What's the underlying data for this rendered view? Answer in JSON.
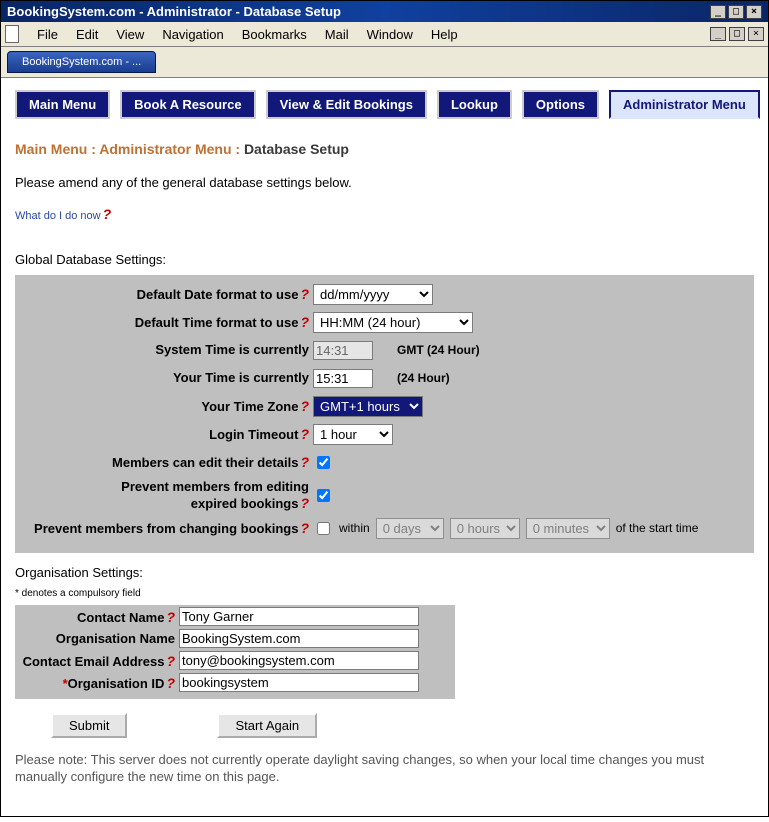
{
  "window": {
    "title": "BookingSystem.com - Administrator - Database Setup"
  },
  "menubar": [
    "File",
    "Edit",
    "View",
    "Navigation",
    "Bookmarks",
    "Mail",
    "Window",
    "Help"
  ],
  "tab": "BookingSystem.com - ...",
  "nav": [
    {
      "label": "Main Menu",
      "active": false
    },
    {
      "label": "Book A Resource",
      "active": false
    },
    {
      "label": "View & Edit Bookings",
      "active": false
    },
    {
      "label": "Lookup",
      "active": false
    },
    {
      "label": "Options",
      "active": false
    },
    {
      "label": "Administrator Menu",
      "active": true
    }
  ],
  "breadcrumb": {
    "part1": "Main Menu : ",
    "part2": "Administrator Menu : ",
    "current": "Database Setup"
  },
  "intro": "Please amend any of the general database settings below.",
  "help": "What do I do now",
  "section1": "Global Database Settings:",
  "settings": {
    "date_label": "Default Date format to use",
    "date_value": "dd/mm/yyyy",
    "time_label": "Default Time format to use",
    "time_value": "HH:MM (24 hour)",
    "systime_label": "System Time is currently",
    "systime_value": "14:31",
    "systime_note": "GMT (24 Hour)",
    "yourtime_label": "Your Time is currently",
    "yourtime_value": "15:31",
    "yourtime_note": "(24 Hour)",
    "tz_label": "Your Time Zone",
    "tz_value": "GMT+1 hours",
    "timeout_label": "Login Timeout",
    "timeout_value": "1 hour",
    "members_edit_label": "Members can edit their details",
    "prevent_expired_label1": "Prevent members from editing",
    "prevent_expired_label2": "expired bookings",
    "prevent_change_label": "Prevent members from changing bookings",
    "within_label": "within",
    "days": "0 days",
    "hours": "0 hours",
    "minutes": "0 minutes",
    "of_start": "of the start time"
  },
  "section2": "Organisation Settings:",
  "compulsory": "* denotes a compulsory field",
  "org": {
    "contact_name_label": "Contact Name",
    "contact_name": "Tony Garner",
    "org_name_label": "Organisation Name",
    "org_name": "BookingSystem.com",
    "email_label": "Contact Email Address",
    "email": "tony@bookingsystem.com",
    "orgid_label": "Organisation ID",
    "orgid": "bookingsystem"
  },
  "buttons": {
    "submit": "Submit",
    "start_again": "Start Again"
  },
  "footnote": "Please note: This server does not currently operate daylight saving changes, so when your local time changes you must manually configure the new time on this page."
}
